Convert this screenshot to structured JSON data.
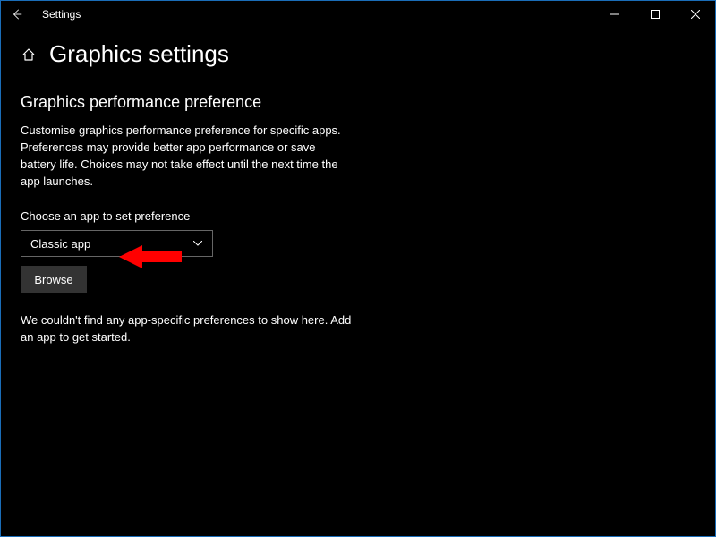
{
  "titlebar": {
    "title": "Settings"
  },
  "page": {
    "title": "Graphics settings"
  },
  "section": {
    "heading": "Graphics performance preference",
    "description": "Customise graphics performance preference for specific apps. Preferences may provide better app performance or save battery life. Choices may not take effect until the next time the app launches.",
    "choose_label": "Choose an app to set preference",
    "dropdown_value": "Classic app",
    "browse_label": "Browse",
    "empty_message": "We couldn't find any app-specific preferences to show here. Add an app to get started."
  },
  "annotation": {
    "arrow_color": "#ff0000"
  }
}
